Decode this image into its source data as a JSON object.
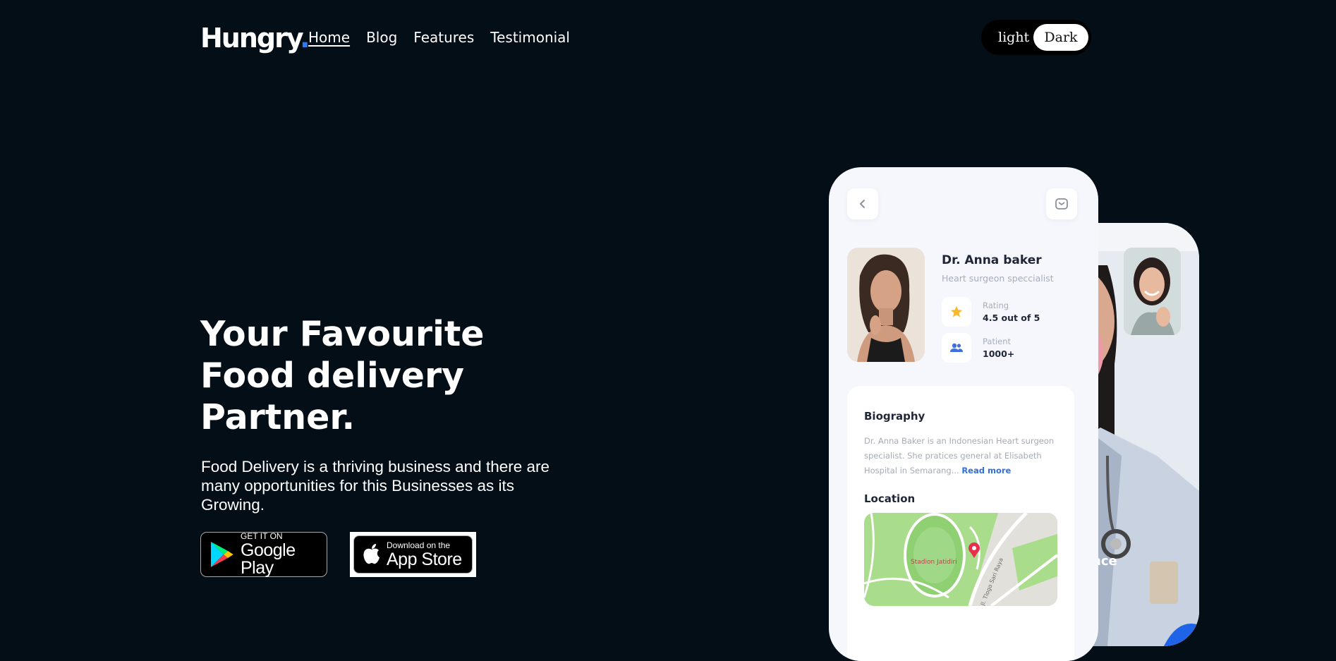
{
  "brand": {
    "name": "Hungry",
    "dot": ".",
    "accent_color": "#2f7bf5"
  },
  "nav": {
    "items": [
      {
        "label": "Home",
        "active": true
      },
      {
        "label": "Blog",
        "active": false
      },
      {
        "label": "Features",
        "active": false
      },
      {
        "label": "Testimonial",
        "active": false
      }
    ]
  },
  "theme_toggle": {
    "light_label": "light",
    "dark_label": "Dark",
    "selected": "Dark"
  },
  "hero": {
    "title_lines": [
      "Your Favourite",
      "Food delivery",
      "Partner."
    ],
    "subtitle": "Food Delivery is a thriving business and there are many opportunities for this Businesses as its Growing."
  },
  "stores": {
    "google": {
      "small": "GET IT ON",
      "big": "Google Play",
      "icon": "google-play-icon"
    },
    "apple": {
      "small": "Download on the",
      "big": "App Store",
      "icon": "apple-icon"
    }
  },
  "phone": {
    "back_icon": "chevron-left-icon",
    "message_icon": "message-icon",
    "doctor": {
      "name": "Dr. Anna baker",
      "specialty": "Heart surgeon speccialist"
    },
    "stats": [
      {
        "icon": "star-icon",
        "label": "Rating",
        "value": "4.5 out of 5"
      },
      {
        "icon": "users-icon",
        "label": "Patient",
        "value": "1000+"
      }
    ],
    "biography": {
      "title": "Biography",
      "text": "Dr. Anna Baker is an Indonesian Heart surgeon specialist. She pratices general at Elisabeth Hospital in Semarang...",
      "read_more": "Read more"
    },
    "location": {
      "title": "Location",
      "map_label": "Stadion Jatidiri",
      "road_label": "Jl. Tlogo Sari Raya"
    }
  },
  "phone_back": {
    "partial_text": "nce"
  }
}
